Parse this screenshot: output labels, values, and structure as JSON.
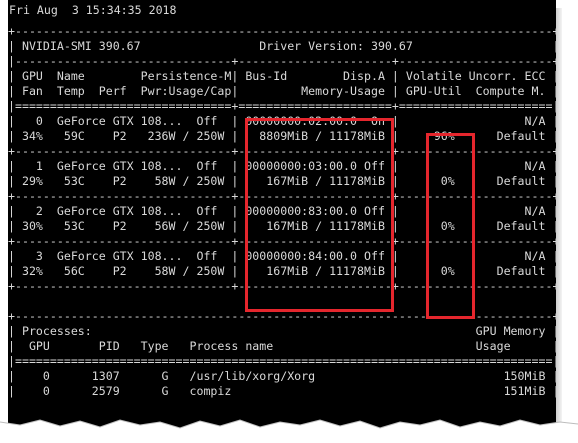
{
  "timestamp": "Fri Aug  3 15:34:35 2018",
  "lines": [
    "+-----------------------------------------------------------------------------+",
    "| NVIDIA-SMI 390.67                 Driver Version: 390.67                    |",
    "|-------------------------------+----------------------+----------------------+",
    "| GPU  Name        Persistence-M| Bus-Id        Disp.A | Volatile Uncorr. ECC |",
    "| Fan  Temp  Perf  Pwr:Usage/Cap|         Memory-Usage | GPU-Util  Compute M. |",
    "|===============================+======================+======================|",
    "|   0  GeForce GTX 108...  Off  | 00000000:02:00.0  On |                  N/A |",
    "| 34%   59C    P2   236W / 250W |   8809MiB / 11178MiB |     96%      Default |",
    "+-------------------------------+----------------------+----------------------+",
    "|   1  GeForce GTX 108...  Off  | 00000000:03:00.0 Off |                  N/A |",
    "| 29%   53C    P2    58W / 250W |    167MiB / 11178MiB |      0%      Default |",
    "+-------------------------------+----------------------+----------------------+",
    "|   2  GeForce GTX 108...  Off  | 00000000:83:00.0 Off |                  N/A |",
    "| 30%   53C    P2    56W / 250W |    167MiB / 11178MiB |      0%      Default |",
    "+-------------------------------+----------------------+----------------------+",
    "|   3  GeForce GTX 108...  Off  | 00000000:84:00.0 Off |                  N/A |",
    "| 32%   56C    P2    58W / 250W |    167MiB / 11178MiB |      0%      Default |",
    "+-------------------------------+----------------------+----------------------+",
    "",
    "+-----------------------------------------------------------------------------+",
    "| Processes:                                                       GPU Memory |",
    "|  GPU       PID   Type   Process name                             Usage      |",
    "|=============================================================================|",
    "|    0      1307      G   /usr/lib/xorg/Xorg                           150MiB |",
    "|    0      2579      G   compiz                                       151MiB |"
  ],
  "highlight_color": "#e5262d",
  "background_color": "#000000",
  "text_color": "#d9d9d9"
}
